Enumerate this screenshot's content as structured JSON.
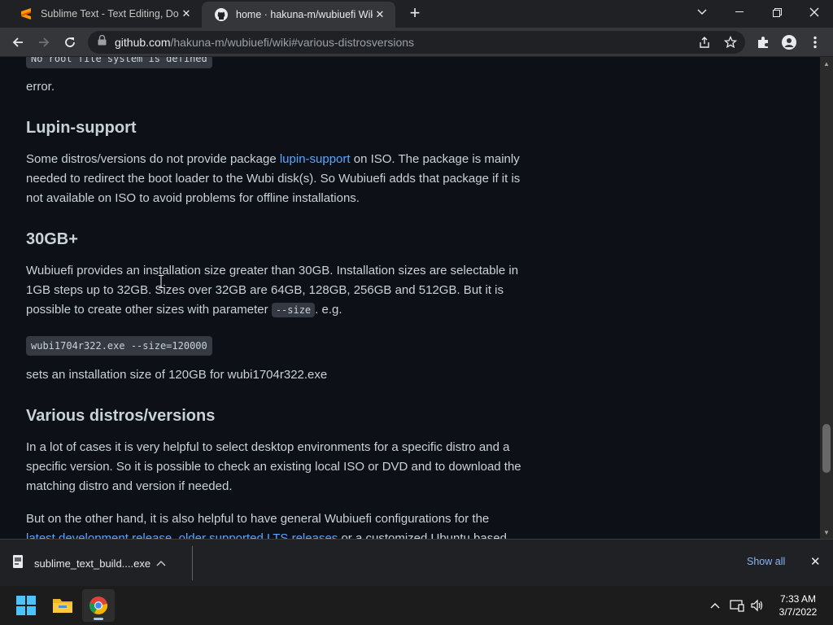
{
  "browser": {
    "tabs": [
      {
        "title": "Sublime Text - Text Editing, Done",
        "icon": "sublime-icon",
        "active": false
      },
      {
        "title": "home · hakuna-m/wubiuefi Wiki",
        "icon": "github-icon",
        "active": true
      }
    ],
    "url_host": "github.com",
    "url_path": "/hakuna-m/wubiuefi/wiki#various-distrosversions"
  },
  "page": {
    "top_code_fragment": "No root file system is defined",
    "error_text": "error.",
    "lupin": {
      "heading": "Lupin-support",
      "text_before": "Some distros/versions do not provide package ",
      "link": "lupin-support",
      "text_after": " on ISO. The package is mainly needed to redirect the boot loader to the Wubi disk(s). So Wubiuefi adds that package if it is not available on ISO to avoid problems for offline installations."
    },
    "size": {
      "heading": "30GB+",
      "text_before": "Wubiuefi provides an installation size greater than 30GB. Installation sizes are selectable in 1GB steps up to 32GB. Sizes over 32GB are 64GB, 128GB, 256GB and 512GB. But it is possible to create other sizes with parameter ",
      "param": "--size",
      "text_after": ". e.g.",
      "code_example": "wubi1704r322.exe --size=120000",
      "result": "sets an installation size of 120GB for wubi1704r322.exe"
    },
    "distros": {
      "heading": "Various distros/versions",
      "para1": "In a lot of cases it is very helpful to select desktop environments for a specific distro and a specific version. So it is possible to check an existing local ISO or DVD and to download the matching distro and version if needed.",
      "para2": "But on the other hand, it is also helpful to have general Wubiuefi configurations for the",
      "link1": "latest development release",
      "sep": ", ",
      "link2": "older supported LTS releases",
      "tail": " or a customized Ubuntu based"
    }
  },
  "download_bar": {
    "filename": "sublime_text_build....exe",
    "show_all": "Show all"
  },
  "taskbar": {
    "time": "7:33 AM",
    "date": "3/7/2022"
  },
  "colors": {
    "page_bg": "#0d1117",
    "text": "#c9d1d9",
    "link": "#58a6ff",
    "code_bg": "#343942"
  }
}
